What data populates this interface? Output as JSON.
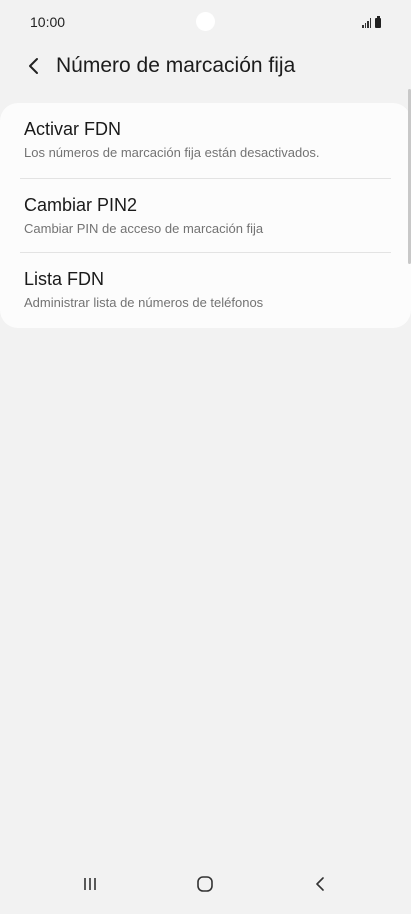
{
  "status_bar": {
    "time": "10:00",
    "icons": [
      "signal-icon",
      "battery-icon"
    ]
  },
  "header": {
    "back_icon": "chevron-left-icon",
    "title": "Número de marcación fija"
  },
  "settings": [
    {
      "title": "Activar FDN",
      "subtitle": "Los números de marcación fija están desactivados."
    },
    {
      "title": "Cambiar PIN2",
      "subtitle": "Cambiar PIN de acceso de marcación fija"
    },
    {
      "title": "Lista FDN",
      "subtitle": "Administrar lista de números de teléfonos"
    }
  ],
  "nav_bar": {
    "icons": [
      "recent-apps-icon",
      "home-icon",
      "back-icon"
    ]
  },
  "colors": {
    "background": "#f2f2f2",
    "card": "#fcfcfc",
    "title_text": "#1a1a1a",
    "subtitle_text": "#737373"
  }
}
